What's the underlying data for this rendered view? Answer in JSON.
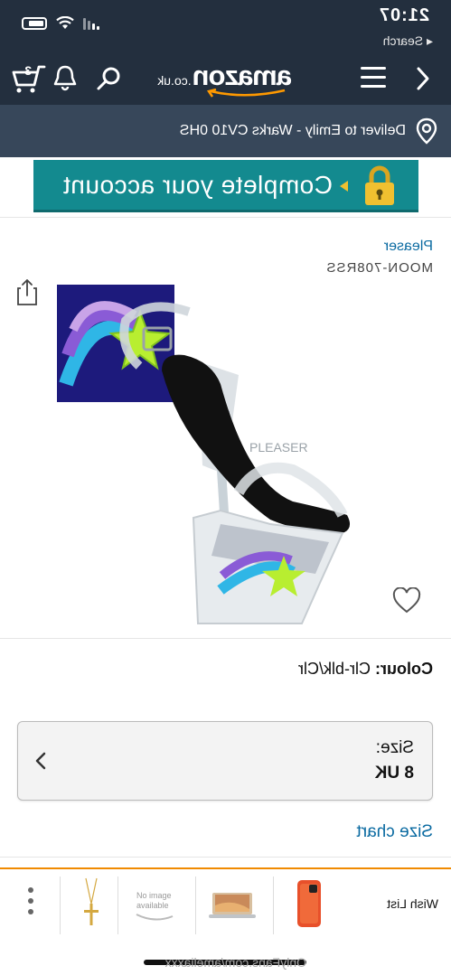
{
  "status": {
    "time": "21:07",
    "back_label": "◂ Search"
  },
  "nav": {
    "logo_word": "amazon",
    "logo_tld": ".co.uk",
    "cart_count": "3"
  },
  "deliver": {
    "text": "Deliver to Emily - Warks CV10 0HS"
  },
  "banner": {
    "text": "Complete your account"
  },
  "product": {
    "brand": "Pleaser",
    "model": "MOON-708RSS",
    "colour_label": "Colour:",
    "colour_value": "Clr-blk/Clr",
    "size_label": "Size:",
    "size_value": "8 UK",
    "size_chart": "Size chart"
  },
  "bottom": {
    "wishlist": "Wish List"
  },
  "watermark": "OnlyFans.com/ameliaxxx",
  "colors": {
    "header": "#232f3e",
    "subheader": "#37475a",
    "banner": "#138a8f",
    "link": "#0a6aa1",
    "accent": "#f08a00"
  }
}
